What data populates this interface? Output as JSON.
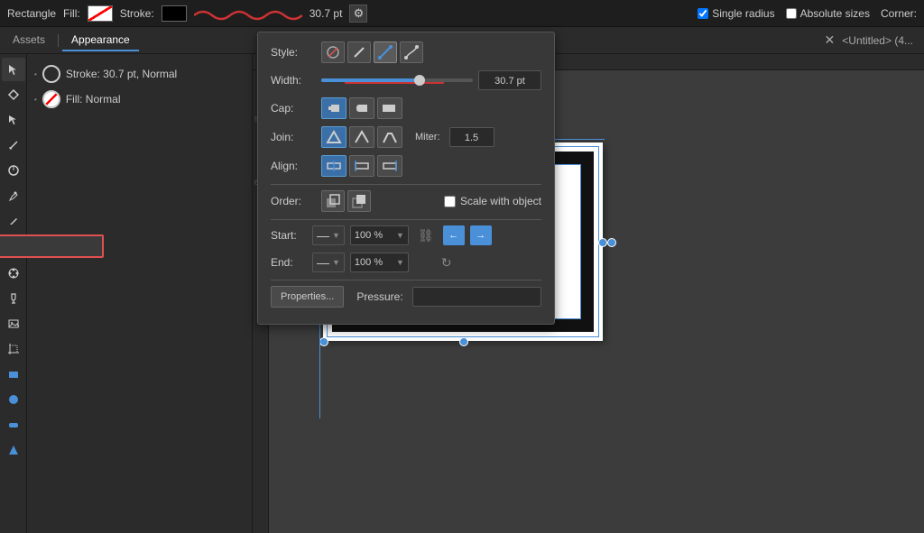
{
  "topbar": {
    "shape_label": "Rectangle",
    "fill_label": "Fill:",
    "stroke_label": "Stroke:",
    "stroke_value": "30.7 pt",
    "single_radius_label": "Single radius",
    "absolute_sizes_label": "Absolute sizes",
    "corner_label": "Corner:",
    "title": "<Untitled> (4..."
  },
  "tabs": {
    "assets_label": "Assets",
    "appearance_label": "Appearance"
  },
  "panel": {
    "stroke_item": "Stroke: 30.7 pt,  Normal",
    "fill_item": "Fill:  Normal"
  },
  "popup": {
    "style_label": "Style:",
    "width_label": "Width:",
    "width_value": "30.7 pt",
    "cap_label": "Cap:",
    "join_label": "Join:",
    "miter_label": "Miter:",
    "miter_value": "1.5",
    "align_label": "Align:",
    "order_label": "Order:",
    "scale_label": "Scale with object",
    "start_label": "Start:",
    "end_label": "End:",
    "start_pct": "100 %",
    "end_pct": "100 %",
    "properties_btn": "Properties...",
    "pressure_label": "Pressure:",
    "slider_pct": 65
  },
  "toolbar": {
    "tools": [
      "↖",
      "⊹",
      "↗",
      "✦",
      "◎",
      "✏",
      "✒",
      "✎",
      "☁",
      "◑",
      "☕",
      "🖼",
      "⊠",
      "▣",
      "●",
      "▬",
      "▲"
    ]
  }
}
